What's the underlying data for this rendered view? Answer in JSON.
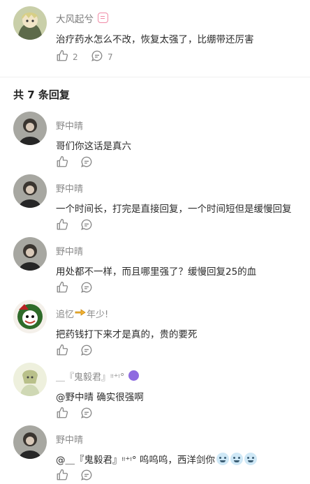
{
  "top_comment": {
    "username": "大风起兮",
    "text": "治疗药水怎么不改，恢复太强了，比绷带还厉害",
    "likes": "2",
    "replies_count": "7"
  },
  "replies_header": {
    "prefix": "共",
    "count": "7",
    "suffix": "条回复"
  },
  "replies": [
    {
      "username": "野中晴",
      "text": "哥们你这话是真六"
    },
    {
      "username": "野中晴",
      "text": "一个时间长，打完是直接回复，一个时间短但是缓慢回复"
    },
    {
      "username": "野中晴",
      "text": "用处都不一样，而且哪里强了？缓慢回复25的血"
    },
    {
      "username_main": "追忆",
      "username_tail": "年少!",
      "text": "把药钱打下来才是真的，贵的要死"
    },
    {
      "username": "＿『鬼毅君』ᵎᵎ⁺ᵎ°",
      "text": "@野中晴 确实很强啊"
    },
    {
      "username": "野中晴",
      "text": "@＿『鬼毅君』ᵎᵎ⁺ᵎ° 呜呜呜，西洋剑你"
    }
  ],
  "colors": {
    "accent_pink": "#f08aa6",
    "badge_purple": "#8e6be0",
    "muted_text": "#8a8a8a",
    "body_text": "#2b2b2b"
  },
  "icons": [
    "thumbs-up-icon",
    "comment-icon",
    "pointing-hand-emoji",
    "crying-emoji"
  ]
}
